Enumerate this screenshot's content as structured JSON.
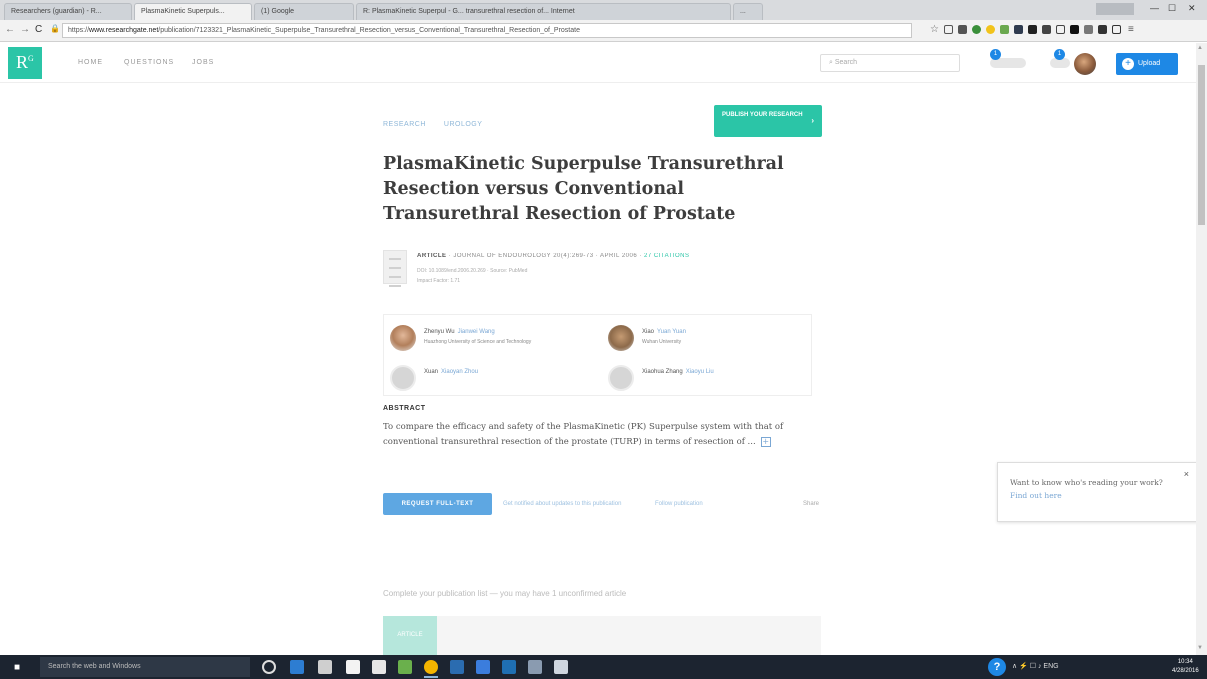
{
  "browser": {
    "tabs": [
      {
        "title": "Researchers (guardian) - R..."
      },
      {
        "title": "PlasmaKinetic Superpuls..."
      },
      {
        "title": "(1) Google"
      },
      {
        "title": "R: PlasmaKinetic Superpul - G...  transurethral resection of... Internet"
      },
      {
        "title": "..."
      }
    ],
    "address": {
      "scheme": "https://",
      "host": "www.researchgate.net",
      "path": "/publication/7123321_PlasmaKinetic_Superpulse_Transurethral_Resection_versus_Conventional_Transurethral_Resection_of_Prostate"
    },
    "window_controls": [
      "—",
      "☐",
      "✕"
    ]
  },
  "site": {
    "logo_letter": "R",
    "logo_sup": "G",
    "nav": [
      "HOME",
      "QUESTIONS",
      "JOBS"
    ],
    "search_placeholder": "Search",
    "notification_count": "1",
    "message_count": "1",
    "upload_label": "Upload"
  },
  "article": {
    "breadcrumbs": [
      "RESEARCH",
      "UROLOGY"
    ],
    "publish_cta": "PUBLISH YOUR RESEARCH",
    "title": "PlasmaKinetic Superpulse Transurethral Resection versus Conventional Transurethral Resection of Prostate",
    "meta": {
      "type": "ARTICLE",
      "journal": "JOURNAL OF ENDOUROLOGY 20(4):269-73 · APRIL 2006",
      "citations": "27 CITATIONS",
      "sub1": "DOI: 10.1089/end.2006.20.269 · Source: PubMed",
      "sub2": "Impact Factor: 1.71"
    },
    "authors": [
      {
        "prefix": "Zhenyu Wu",
        "name": "Jianwei Wang",
        "aff": "Huazhong University of Science and Technology",
        "pic": "p1"
      },
      {
        "prefix": "Xiao",
        "name": "Yuan Yuan",
        "aff": "Wuhan University",
        "pic": "p2"
      },
      {
        "prefix": "Xuan",
        "name": "Xiaoyan Zhou",
        "aff": "",
        "pic": "gray"
      },
      {
        "prefix": "Xiaohua Zhang",
        "name": "Xiaoyu Liu",
        "aff": "",
        "pic": "gray"
      }
    ],
    "abstract_label": "ABSTRACT",
    "abstract_text": "To compare the efficacy and safety of the PlasmaKinetic (PK) Superpulse system with that of conventional transurethral resection of the prostate (TURP) in terms of resection of ...",
    "expand_label": "+",
    "request_button": "REQUEST FULL-TEXT",
    "links": [
      "Get notified about updates to this publication",
      "Follow publication"
    ],
    "share_label": "Share",
    "suggest_text": "Complete your publication list — you may have 1 unconfirmed article",
    "card_thumb_label": "ARTICLE"
  },
  "toast": {
    "text": "Want to know who's reading your work?",
    "link": "Find out here",
    "close": "×"
  },
  "taskbar": {
    "search_placeholder": "Search the web and Windows",
    "tray_text": "∧  ⚡ ☐ ♪ ENG",
    "time": "10:34",
    "date": "4/28/2016"
  },
  "colors": {
    "brand_teal": "#2bc5a7",
    "link_blue": "#7aa7d4",
    "button_blue": "#1e88e5"
  }
}
